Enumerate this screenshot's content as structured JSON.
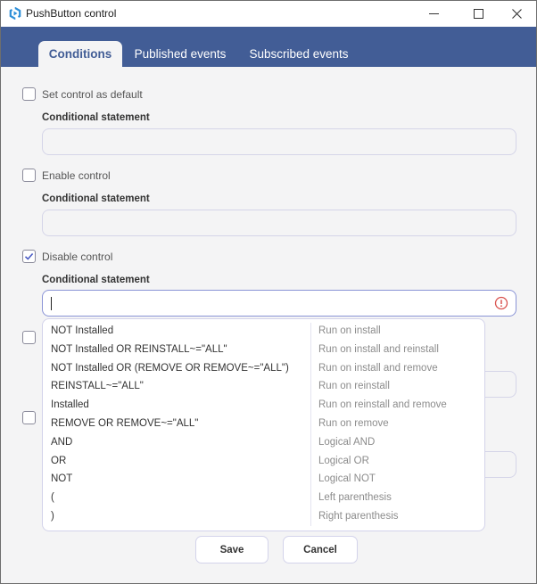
{
  "window": {
    "title": "PushButton control",
    "controls": [
      "minimize",
      "maximize",
      "close"
    ]
  },
  "colors": {
    "tab_bar": "#425d96",
    "active_tab_text": "#425d96",
    "error": "#d9534f",
    "focus_border": "#8a94d6"
  },
  "tabs": [
    {
      "label": "Conditions",
      "active": true
    },
    {
      "label": "Published events",
      "active": false
    },
    {
      "label": "Subscribed events",
      "active": false
    }
  ],
  "sections": [
    {
      "checkbox_label": "Set control as default",
      "checked": false,
      "field_label": "Conditional statement",
      "value": ""
    },
    {
      "checkbox_label": "Enable control",
      "checked": false,
      "field_label": "Conditional statement",
      "value": ""
    },
    {
      "checkbox_label": "Disable control",
      "checked": true,
      "field_label": "Conditional statement",
      "value": "",
      "focused": true,
      "error": true
    },
    {
      "checkbox_label": "",
      "checked": false
    },
    {
      "checkbox_label": "",
      "checked": false
    }
  ],
  "dropdown": {
    "items": [
      {
        "condition": "NOT Installed",
        "description": "Run on install"
      },
      {
        "condition": "NOT Installed OR REINSTALL~=\"ALL\"",
        "description": "Run on install and reinstall"
      },
      {
        "condition": "NOT Installed OR (REMOVE OR REMOVE~=\"ALL\")",
        "description": "Run on install and remove"
      },
      {
        "condition": "REINSTALL~=\"ALL\"",
        "description": "Run on reinstall"
      },
      {
        "condition": "Installed",
        "description": "Run on reinstall and remove"
      },
      {
        "condition": "REMOVE OR REMOVE~=\"ALL\"",
        "description": "Run on remove"
      },
      {
        "condition": "AND",
        "description": "Logical AND"
      },
      {
        "condition": "OR",
        "description": "Logical OR"
      },
      {
        "condition": "NOT",
        "description": "Logical NOT"
      },
      {
        "condition": "(",
        "description": "Left parenthesis"
      },
      {
        "condition": ")",
        "description": "Right parenthesis"
      }
    ]
  },
  "footer": {
    "save_label": "Save",
    "cancel_label": "Cancel"
  }
}
